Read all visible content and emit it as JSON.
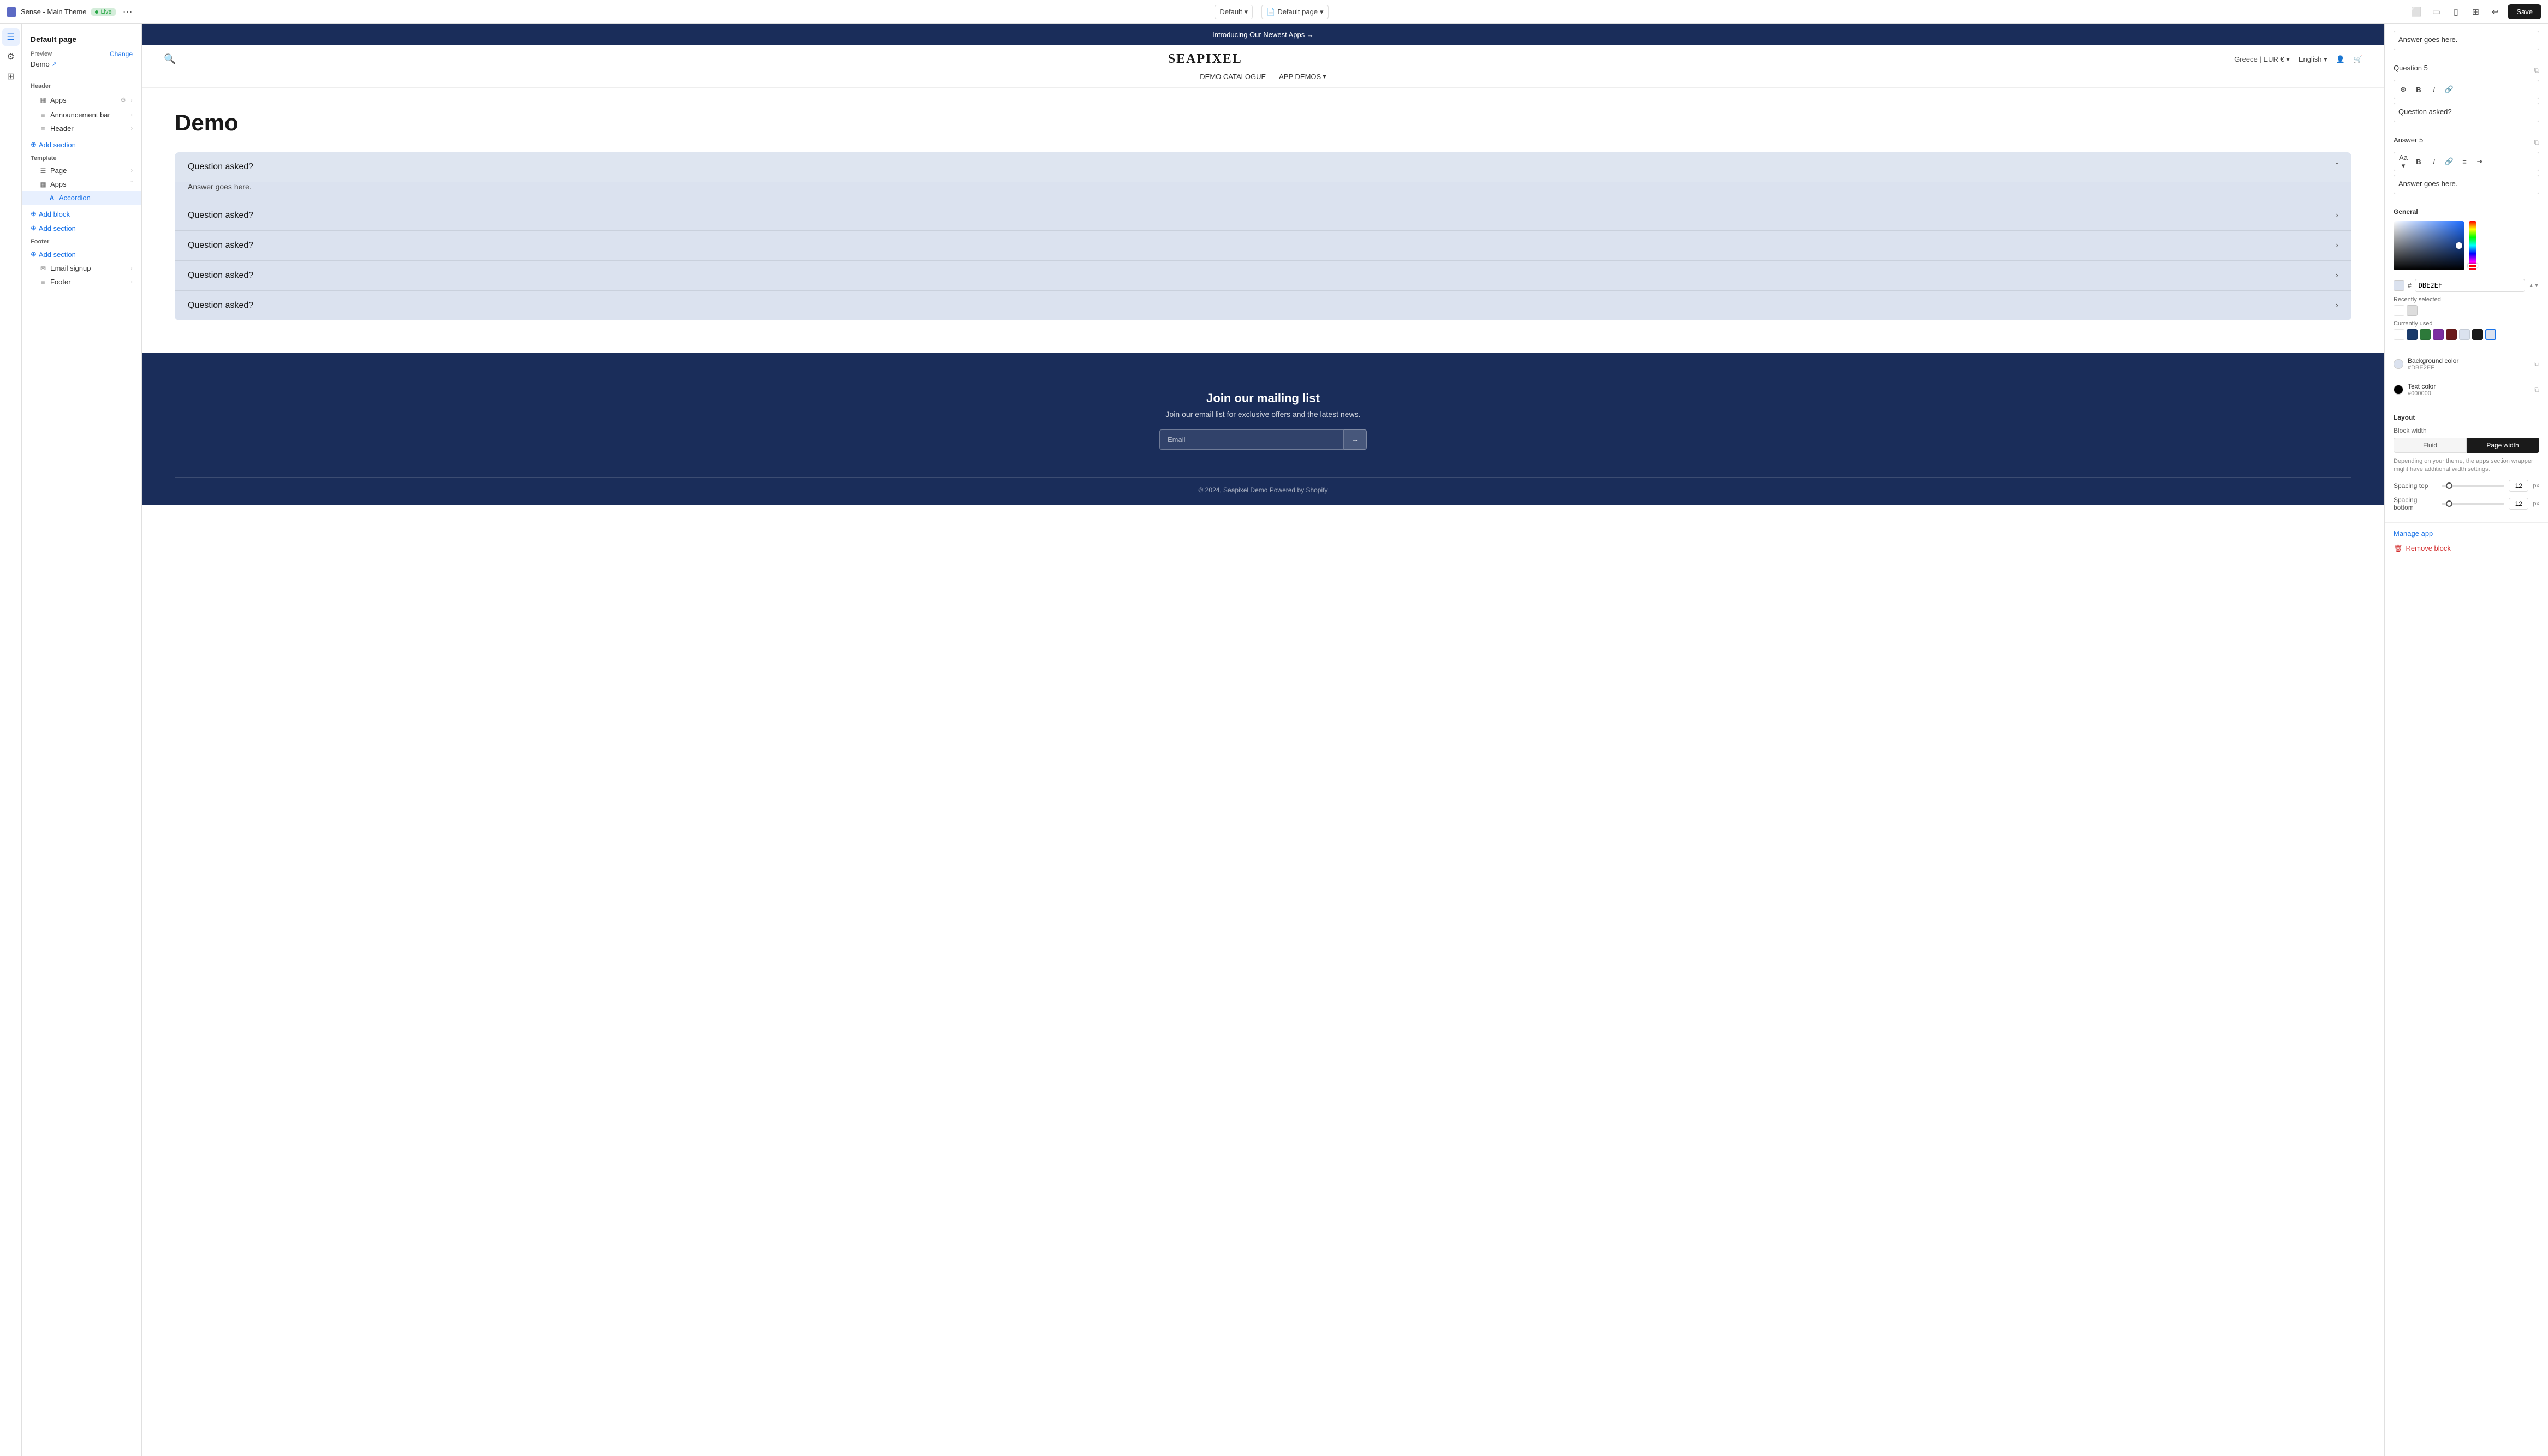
{
  "topbar": {
    "title": "Sense - Main Theme",
    "live_label": "Live",
    "more_label": "···",
    "center": {
      "default_label": "Default",
      "page_label": "Default page"
    },
    "save_label": "Save",
    "icons": [
      "desktop",
      "tablet",
      "mobile",
      "layout",
      "undo"
    ]
  },
  "left_panel": {
    "page_title": "Default page",
    "preview": {
      "label": "Preview",
      "change": "Change",
      "demo_label": "Demo",
      "link_icon": "↗"
    },
    "header_section": {
      "title": "Header",
      "items": [
        {
          "label": "Apps",
          "icon": "▦",
          "indent": true
        },
        {
          "label": "Announcement bar",
          "icon": "≡",
          "indent": true
        },
        {
          "label": "Header",
          "icon": "≡",
          "indent": true
        }
      ]
    },
    "add_section_1": "Add section",
    "template_section": {
      "title": "Template",
      "items": [
        {
          "label": "Page",
          "icon": "☰",
          "indent": true
        },
        {
          "label": "Apps",
          "icon": "▦",
          "indent": true,
          "expanded": true,
          "children": [
            {
              "label": "Accordion",
              "icon": "A",
              "indent2": true,
              "active": true
            }
          ]
        }
      ]
    },
    "add_block_label": "Add block",
    "add_section_2": "Add section",
    "footer_section": {
      "title": "Footer",
      "items": [
        {
          "label": "Add section",
          "icon": "+",
          "is_add": true
        },
        {
          "label": "Email signup",
          "icon": "✉",
          "indent": true
        },
        {
          "label": "Footer",
          "icon": "≡",
          "indent": true
        }
      ]
    }
  },
  "preview": {
    "announcement_bar": {
      "text": "Introducing Our Newest Apps →"
    },
    "header": {
      "search_icon": "🔍",
      "logo": "SEAPIXEL",
      "region": "Greece | EUR €",
      "language": "English",
      "nav": [
        {
          "label": "DEMO CATALOGUE"
        },
        {
          "label": "APP DEMOS",
          "has_dropdown": true
        }
      ]
    },
    "page_title": "Demo",
    "accordion": {
      "items": [
        {
          "question": "Question asked?",
          "answer": "Answer goes here.",
          "open": true
        },
        {
          "question": "Question asked?",
          "open": false
        },
        {
          "question": "Question asked?",
          "open": false
        },
        {
          "question": "Question asked?",
          "open": false
        },
        {
          "question": "Question asked?",
          "open": false
        }
      ]
    },
    "footer": {
      "signup_title": "Join our mailing list",
      "signup_desc": "Join our email list for exclusive offers and the latest news.",
      "email_placeholder": "Email",
      "submit_icon": "→",
      "copyright": "© 2024, Seapixel Demo Powered by Shopify"
    }
  },
  "right_panel": {
    "answer_preview": "Answer goes here.",
    "question5": {
      "label": "Question 5",
      "toolbar_icons": [
        "format",
        "B",
        "I",
        "link"
      ],
      "question_value": "Question asked?"
    },
    "answer5": {
      "label": "Answer 5",
      "toolbar_icons": [
        "Aa",
        "B",
        "I",
        "link",
        "list",
        "indent"
      ],
      "answer_value": "Answer goes here."
    },
    "general_label": "General",
    "color_hex": "DBE2EF",
    "recently_selected_label": "Recently selected",
    "currently_used_label": "Currently used",
    "swatches_used": [
      "#fff",
      "#1a3a6b",
      "#2d7a3a",
      "#7b2fa0",
      "#6b1a1a",
      "#dbe2ef",
      "#1a1a1a"
    ],
    "bg_color_label": "Background color",
    "bg_color_value": "#DBE2EF",
    "text_color_label": "Text color",
    "text_color_value": "#000000",
    "layout_label": "Layout",
    "block_width_label": "Block width",
    "fluid_label": "Fluid",
    "page_width_label": "Page width",
    "layout_desc": "Depending on your theme, the apps section wrapper might have additional width settings.",
    "spacing_top_label": "Spacing top",
    "spacing_top_value": "12",
    "spacing_top_unit": "px",
    "spacing_bottom_label": "Spacing bottom",
    "spacing_bottom_value": "12",
    "spacing_bottom_unit": "px",
    "manage_app_label": "Manage app",
    "remove_block_label": "Remove block"
  }
}
